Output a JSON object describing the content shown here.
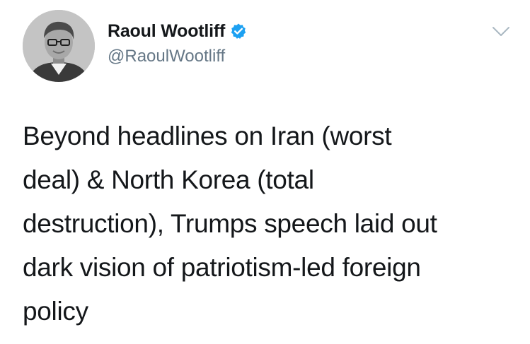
{
  "tweet": {
    "author": {
      "display_name": "Raoul Wootliff",
      "handle": "@RaoulWootliff",
      "verified": true,
      "avatar": "profile-photo"
    },
    "menu_icon": "chevron-down-icon",
    "text_lines": [
      "Beyond headlines on Iran (worst",
      "deal) & North Korea (total",
      "destruction), Trumps speech laid out",
      "dark vision of patriotism-led foreign",
      "policy"
    ]
  },
  "colors": {
    "text": "#14171a",
    "handle": "#657786",
    "verified_badge": "#1da1f2",
    "caret": "#aab8c2",
    "background": "#ffffff"
  }
}
